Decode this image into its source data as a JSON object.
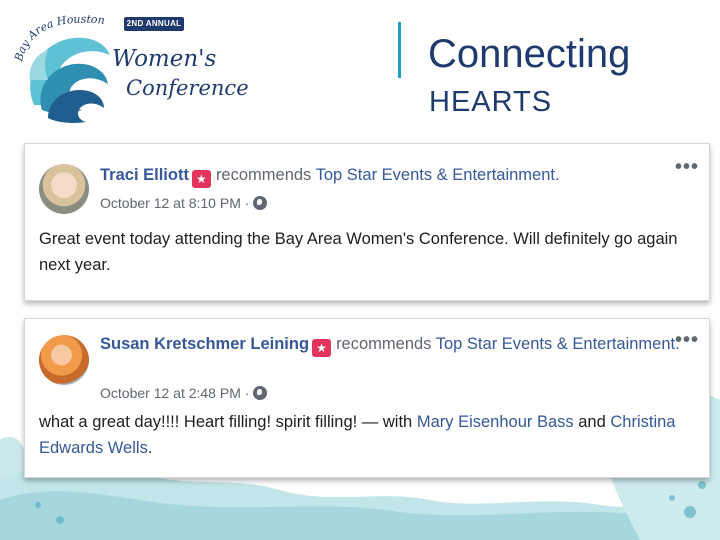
{
  "logo": {
    "badge": "2ND ANNUAL",
    "arc_text": "Bay Area Houston",
    "line1": "Women's",
    "line2": "Conference"
  },
  "heading": {
    "line1": "Connecting",
    "line2": "HEARTS"
  },
  "colors": {
    "navy": "#1f3b6e",
    "teal": "#1fa0bc",
    "fb_blue": "#365899",
    "recommend_red": "#e3345d"
  },
  "posts": [
    {
      "author": "Traci Elliott",
      "action_icon": "recommend-flag-icon",
      "verb": "recommends",
      "page": "Top Star Events & Entertainment.",
      "timestamp": "October 12 at 8:10 PM",
      "separator": "·",
      "privacy_icon": "globe-icon",
      "menu_icon": "•••",
      "body": "Great event today attending the Bay Area Women's Conference. Will definitely go again next year."
    },
    {
      "author": "Susan Kretschmer Leining",
      "action_icon": "recommend-flag-icon",
      "verb": "recommends",
      "page": "Top Star Events & Entertainment.",
      "timestamp": "October 12 at 2:48 PM",
      "separator": "·",
      "privacy_icon": "globe-icon",
      "menu_icon": "•••",
      "body_text": "what a great day!!!! Heart filling! spirit filling! — with",
      "tag1": "Mary Eisenhour Bass",
      "conjunction": "and",
      "tag2": "Christina Edwards Wells",
      "end": "."
    }
  ]
}
